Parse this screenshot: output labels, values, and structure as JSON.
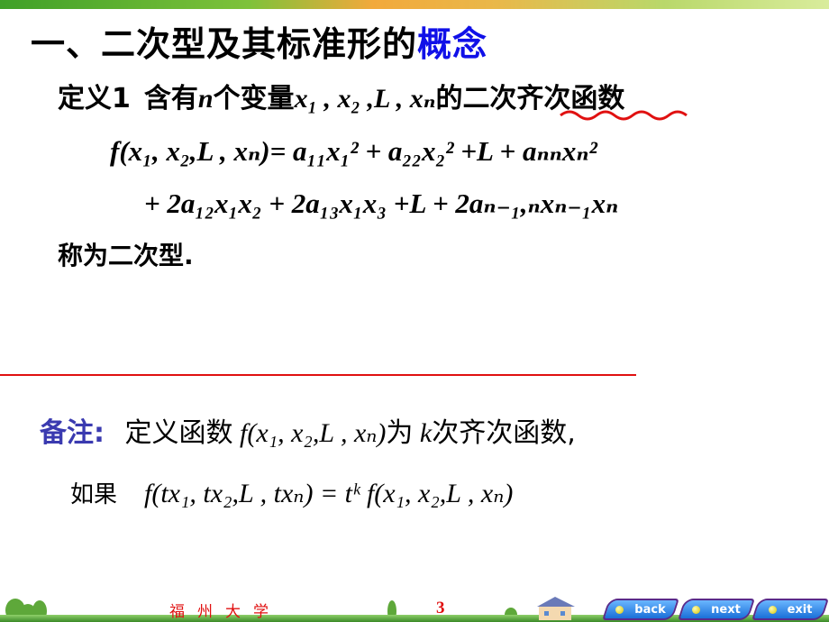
{
  "title": {
    "main": "一、二次型及其标准形的",
    "accent": "概念"
  },
  "definition": {
    "label": "定义1",
    "intro": "含有",
    "n": "n",
    "mid": "个变量",
    "vars": "x₁ , x₂ ,L , xₙ",
    "of": "的",
    "term": "二次齐次函数"
  },
  "formula": {
    "line1": "f(x₁, x₂,L , xₙ)= a₁₁x₁² + a₂₂x₂² +L + aₙₙxₙ²",
    "line2": "+ 2a₁₂x₁x₂ + 2a₁₃x₁x₃ +L + 2aₙ₋₁,ₙxₙ₋₁xₙ"
  },
  "called": "称为二次型.",
  "remark": {
    "label": "备注:",
    "text1": "定义函数",
    "func": "f(x₁, x₂,L , xₙ)",
    "text2": "为",
    "k": "k",
    "text3": "次齐次函数,",
    "if": "如果",
    "condition": "f(tx₁, tx₂,L , txₙ) = tᵏ f(x₁, x₂,L , xₙ)"
  },
  "footer": {
    "university": "福州大学",
    "page": "3",
    "buttons": [
      "back",
      "next",
      "exit"
    ]
  },
  "colors": {
    "accent": "#1010e8",
    "remark": "#3a3ab0",
    "footer_text": "#e01010",
    "divider": "#e01010"
  }
}
